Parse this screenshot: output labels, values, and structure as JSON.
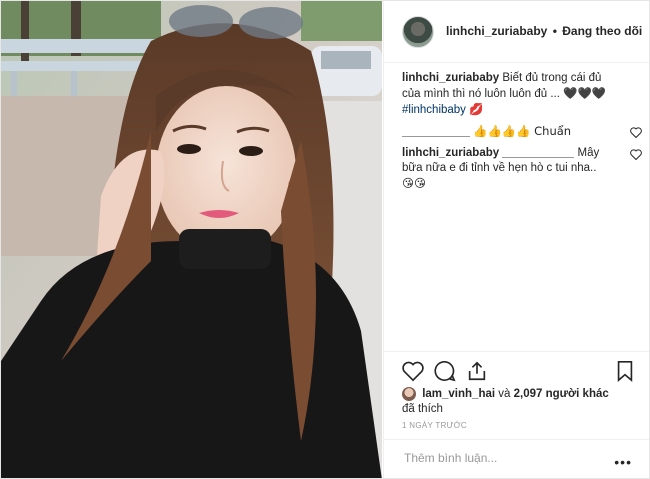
{
  "post": {
    "author": "linhchi_zuriababy",
    "follow_state": "Đang theo dõi",
    "separator": "•"
  },
  "comments": [
    {
      "user": "linhchi_zuriababy",
      "text": "Biết đủ trong cái đủ của mình thì nó luôn luôn đủ ...",
      "hashtag": "#linhchibaby",
      "emoji_after_text": "🖤🖤🖤",
      "emoji_after_tag": "💋"
    },
    {
      "user": "",
      "text": "👍👍👍👍 Chuẩn"
    },
    {
      "user": "linhchi_zuriababy",
      "text": "Mây bữa nữa e đi tỉnh về hẹn hò c tui nha..",
      "emoji": "😘😘"
    }
  ],
  "likes": {
    "first_liker": "lam_vinh_hai",
    "connector": "và",
    "others_count": "2,097 người khác",
    "suffix": "đã thích"
  },
  "timestamp": "1 NGÀY TRƯỚC",
  "comment_input": {
    "placeholder": "Thêm bình luận...",
    "more": "•••"
  },
  "colors": {
    "text": "#262626",
    "muted": "#999999",
    "hashtag": "#003569",
    "border": "#efefef"
  }
}
